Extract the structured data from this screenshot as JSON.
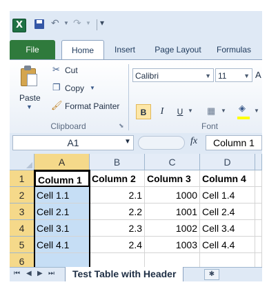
{
  "quick_access": {
    "app_icon": "excel-icon",
    "icons": [
      "save-icon",
      "undo-icon",
      "redo-icon",
      "customize-icon"
    ]
  },
  "tabs": [
    {
      "label": "File"
    },
    {
      "label": "Home"
    },
    {
      "label": "Insert"
    },
    {
      "label": "Page Layout"
    },
    {
      "label": "Formulas"
    }
  ],
  "ribbon": {
    "clipboard": {
      "paste": "Paste",
      "cut": "Cut",
      "copy": "Copy",
      "format_painter": "Format Painter",
      "group_label": "Clipboard"
    },
    "font": {
      "name": "Calibri",
      "size": "11",
      "bold": "B",
      "italic": "I",
      "underline": "U",
      "group_label": "Font"
    }
  },
  "formula_bar": {
    "name_box": "A1",
    "fx": "fx",
    "content": "Column 1"
  },
  "grid": {
    "columns": [
      "A",
      "B",
      "C",
      "D"
    ],
    "rows": [
      "1",
      "2",
      "3",
      "4",
      "5",
      "6"
    ],
    "cells": [
      [
        "Column 1",
        "Column 2",
        "Column 3",
        "Column 4"
      ],
      [
        "Cell 1.1",
        "2.1",
        "1000",
        "Cell 1.4"
      ],
      [
        "Cell 2.1",
        "2.2",
        "1001",
        "Cell 2.4"
      ],
      [
        "Cell 3.1",
        "2.3",
        "1002",
        "Cell 3.4"
      ],
      [
        "Cell 4.1",
        "2.4",
        "1003",
        "Cell 4.4"
      ],
      [
        "",
        "",
        "",
        ""
      ]
    ]
  },
  "sheet_tabs": {
    "active": "Test Table with Header"
  },
  "colors": {
    "file_tab": "#2f7a3c",
    "selection_fill": "#c6def5",
    "header_highlight": "#f5d98a"
  }
}
